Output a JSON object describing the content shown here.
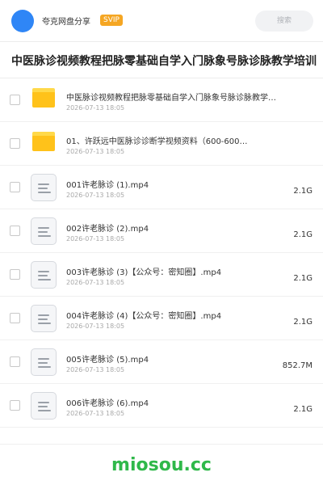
{
  "header": {
    "share_name": "夸克网盘分享",
    "badge": "SVIP",
    "search_placeholder": "搜索",
    "accent_color": "#2f86f6",
    "badge_color": "#f5a623"
  },
  "title": "中医脉诊视频教程把脉零基础自学入门脉象号脉诊脉教学培训",
  "files": [
    {
      "type": "folder",
      "icon": "folder-icon",
      "name": "中医脉诊视频教程把脉零基础自学入门脉象号脉诊脉教学…",
      "date": "2026-07-13 18:05",
      "size": ""
    },
    {
      "type": "folder",
      "icon": "folder-icon",
      "name": "01、许跃远中医脉诊诊断学视频资料（600-600…",
      "date": "2026-07-13 18:05",
      "size": ""
    },
    {
      "type": "file",
      "icon": "document-icon",
      "name": "001许老脉诊 (1).mp4",
      "date": "2026-07-13 18:05",
      "size": "2.1G"
    },
    {
      "type": "file",
      "icon": "document-icon",
      "name": "002许老脉诊 (2).mp4",
      "date": "2026-07-13 18:05",
      "size": "2.1G"
    },
    {
      "type": "file",
      "icon": "document-icon",
      "name": "003许老脉诊 (3)【公众号：密知圈】.mp4",
      "date": "2026-07-13 18:05",
      "size": "2.1G"
    },
    {
      "type": "file",
      "icon": "document-icon",
      "name": "004许老脉诊 (4)【公众号：密知圈】.mp4",
      "date": "2026-07-13 18:05",
      "size": "2.1G"
    },
    {
      "type": "file",
      "icon": "document-icon",
      "name": "005许老脉诊 (5).mp4",
      "date": "2026-07-13 18:05",
      "size": "852.7M"
    },
    {
      "type": "file",
      "icon": "document-icon",
      "name": "006许老脉诊 (6).mp4",
      "date": "2026-07-13 18:05",
      "size": "2.1G"
    }
  ],
  "watermark": "miosou.cc",
  "watermark_color": "#2fb84a"
}
